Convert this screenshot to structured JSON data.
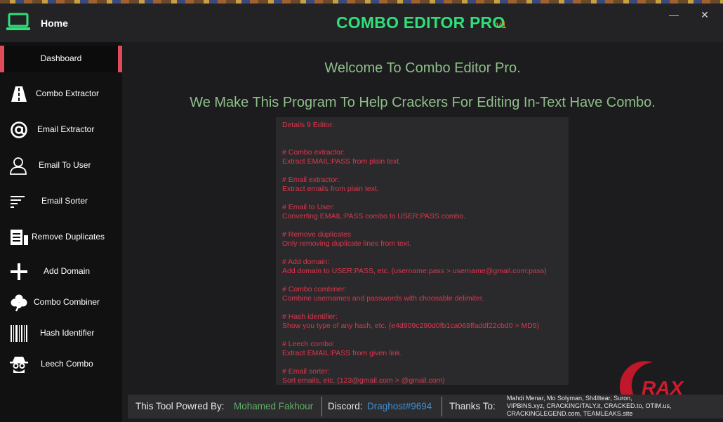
{
  "titlebar": {
    "home_label": "Home",
    "app_title": "COMBO EDITOR PRO",
    "app_version": "v1",
    "minimize_glyph": "—",
    "close_glyph": "✕"
  },
  "sidebar": {
    "dashboard_label": "Dashboard",
    "items": [
      {
        "label": "Combo Extractor",
        "icon": "road-icon"
      },
      {
        "label": "Email Extractor",
        "icon": "at-sign-icon"
      },
      {
        "label": "Email To User",
        "icon": "user-icon"
      },
      {
        "label": "Email Sorter",
        "icon": "sort-lines-icon"
      },
      {
        "label": "Remove Duplicates",
        "icon": "documents-icon"
      },
      {
        "label": "Add Domain",
        "icon": "plus-icon"
      },
      {
        "label": "Combo Combiner",
        "icon": "clover-icon"
      },
      {
        "label": "Hash Identifier",
        "icon": "barcode-icon"
      },
      {
        "label": "Leech Combo",
        "icon": "spy-icon"
      }
    ]
  },
  "main": {
    "welcome": "Welcome To Combo Editor Pro.",
    "tagline": "We Make This Program To Help Crackers For Editing In-Text Have Combo.",
    "details_lines": [
      "Details 9 Editor:",
      "",
      "",
      "# Combo extractor:",
      "Extract EMAIL:PASS from plain text.",
      "",
      "# Email extractor:",
      "Extract emails from plain text.",
      "",
      "# Email to User:",
      "Converting EMAIL:PASS combo to USER:PASS combo.",
      "",
      "# Remove duplicates",
      "Only removing duplicate lines from text.",
      "",
      "# Add domain:",
      "Add domain to USER:PASS, etc. (username:pass > username@gmail.com:pass)",
      "",
      "# Combo combiner:",
      "Combine usernames and passwords with choosable delimiter.",
      "",
      "# Hash identifier:",
      "Show you type of any hash, etc. (e4d909c290d0fb1ca068ffaddf22cbd0 > MD5)",
      "",
      "# Leech combo:",
      "Extract EMAIL:PASS from given link.",
      "",
      "# Email sorter:",
      "Sort emails, etc. (123@gmail.com > @gmail.com)"
    ]
  },
  "footer": {
    "powered_label": "This Tool Powred By:",
    "powered_name": "Mohamed Fakhour",
    "discord_label": "Discord:",
    "discord_handle": "Draghost#9694",
    "thanks_label": "Thanks To:",
    "thanks_lines": [
      "Mahdi Menar, Mo Solyman, Sh4lltear, Suron,",
      "VIPBINS.xyz, CRACKINGITALY.it, CRACKED.to, OTIM.us,",
      "CRACKINGLEGEND.com, TEAMLEAKS.site"
    ]
  },
  "watermark": {
    "logo_text": "RAX"
  },
  "colors": {
    "accent_green": "#2ee07a",
    "version_orange": "#e89a1e",
    "dashboard_marker": "#e14a5a",
    "details_text": "#e0354c",
    "heading_green": "#8fbf8a",
    "discord_blue": "#3e8ed0"
  }
}
